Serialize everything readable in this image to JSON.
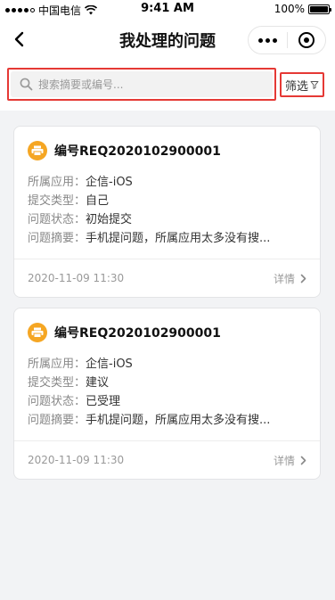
{
  "status_bar": {
    "carrier": "中国电信",
    "time": "9:41 AM",
    "battery": "100%",
    "battery_level": 1.0
  },
  "nav": {
    "title": "我处理的问题"
  },
  "search": {
    "placeholder": "搜索摘要或编号...",
    "value": ""
  },
  "filter": {
    "label": "筛选"
  },
  "cards": [
    {
      "title": "编号REQ2020102900001",
      "app_label": "所属应用：",
      "app_value": "企信-iOS",
      "type_label": "提交类型：",
      "type_value": "自己",
      "status_label": "问题状态：",
      "status_value": "初始提交",
      "summary_label": "问题摘要：",
      "summary_value": "手机提问题，所属应用太多没有搜...",
      "datetime": "2020-11-09  11:30",
      "detail_label": "详情"
    },
    {
      "title": "编号REQ2020102900001",
      "app_label": "所属应用：",
      "app_value": "企信-iOS",
      "type_label": "提交类型：",
      "type_value": "建议",
      "status_label": "问题状态：",
      "status_value": "已受理",
      "summary_label": "问题摘要：",
      "summary_value": "手机提问题，所属应用太多没有搜...",
      "datetime": "2020-11-09  11:30",
      "detail_label": "详情"
    }
  ],
  "colors": {
    "accent_icon": "#f5a623",
    "highlight_border": "#e53935",
    "background": "#f2f3f5"
  }
}
